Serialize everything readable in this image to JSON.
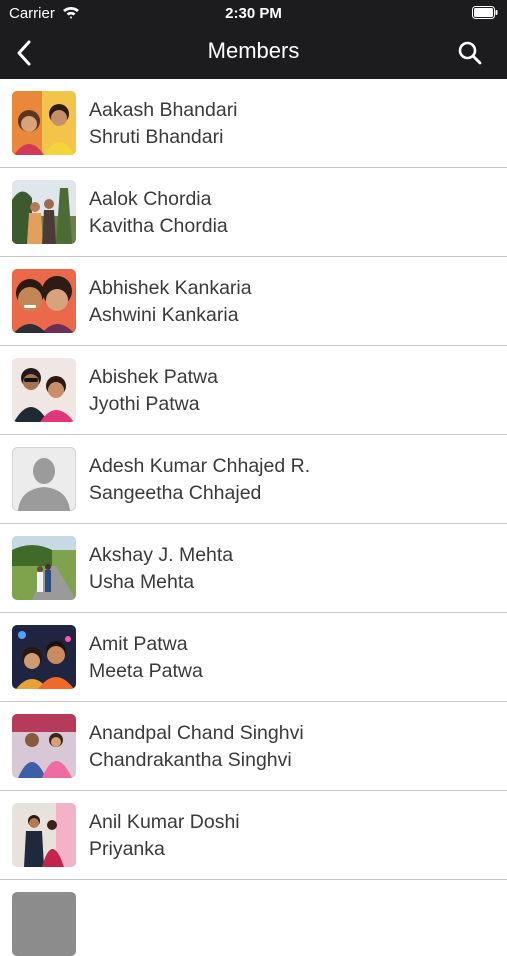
{
  "status": {
    "carrier": "Carrier",
    "time": "2:30 PM"
  },
  "nav": {
    "title": "Members",
    "back_icon": "chevron-left-icon",
    "search_icon": "search-icon"
  },
  "colors": {
    "bar": "#1c1c1e",
    "text": "#3a3a3c",
    "separator": "#c8c8cc"
  },
  "members": [
    {
      "name": "Aakash Bhandari",
      "spouse": "Shruti Bhandari"
    },
    {
      "name": "Aalok Chordia",
      "spouse": "Kavitha Chordia"
    },
    {
      "name": "Abhishek Kankaria",
      "spouse": "Ashwini Kankaria"
    },
    {
      "name": "Abishek Patwa",
      "spouse": "Jyothi Patwa"
    },
    {
      "name": "Adesh Kumar Chhajed R.",
      "spouse": "Sangeetha Chhajed"
    },
    {
      "name": "Akshay J. Mehta",
      "spouse": "Usha Mehta"
    },
    {
      "name": "Amit Patwa",
      "spouse": "Meeta Patwa"
    },
    {
      "name": "Anandpal Chand Singhvi",
      "spouse": "Chandrakantha Singhvi"
    },
    {
      "name": "Anil Kumar Doshi",
      "spouse": "Priyanka"
    }
  ]
}
